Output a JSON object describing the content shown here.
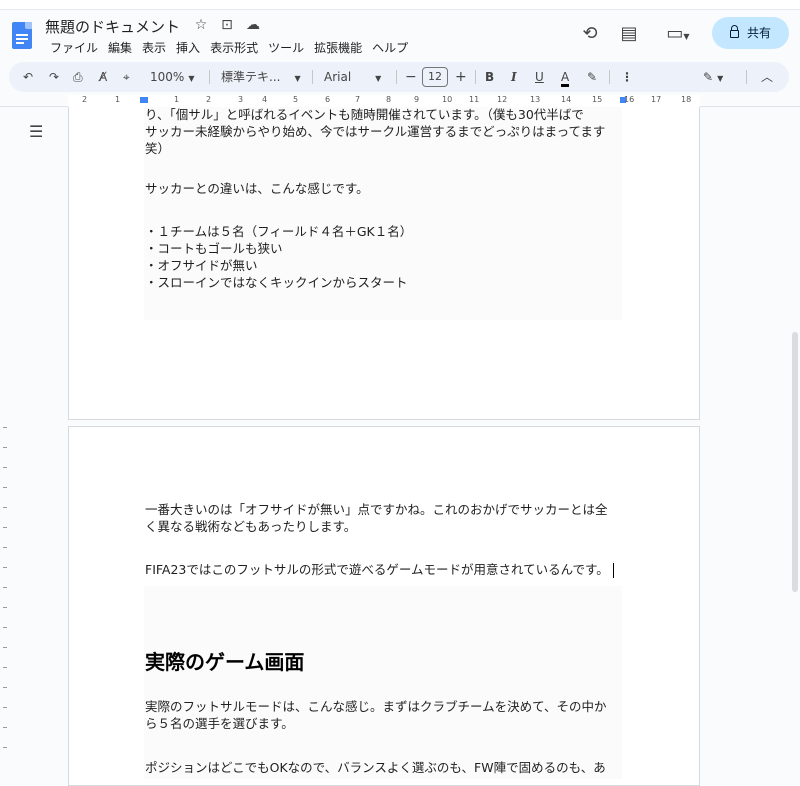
{
  "header": {
    "doc_title": "無題のドキュメント",
    "menus": [
      "ファイル",
      "編集",
      "表示",
      "挿入",
      "表示形式",
      "ツール",
      "拡張機能",
      "ヘルプ"
    ],
    "share_label": "共有"
  },
  "toolbar": {
    "zoom": "100%",
    "style": "標準テキ...",
    "font": "Arial",
    "font_size": "12",
    "bold": "B",
    "italic": "I",
    "underline": "U",
    "text_color": "A"
  },
  "ruler": {
    "numbers": [
      "2",
      "1",
      "1",
      "2",
      "3",
      "4",
      "5",
      "6",
      "7",
      "8",
      "9",
      "10",
      "11",
      "12",
      "13",
      "14",
      "15",
      "16",
      "17",
      "18"
    ]
  },
  "page1": {
    "lines": [
      "り、「個サル」と呼ばれるイベントも随時開催されています。（僕も30代半ばで",
      "サッカー未経験からやり始め、今ではサークル運営するまでどっぷりはまってます",
      "笑）"
    ],
    "diff_intro": "サッカーとの違いは、こんな感じです。",
    "bullets": [
      "・１チームは５名（フィールド４名＋GK１名）",
      "・コートもゴールも狭い",
      "・オフサイドが無い",
      "・スローインではなくキックインからスタート"
    ]
  },
  "page2": {
    "para1": [
      "一番大きいのは「オフサイドが無い」点ですかね。これのおかげでサッカーとは全",
      "く異なる戦術などもあったりします。"
    ],
    "para2": "FIFA23ではこのフットサルの形式で遊べるゲームモードが用意されているんです。",
    "heading": "実際のゲーム画面",
    "para3": [
      "実際のフットサルモードは、こんな感じ。まずはクラブチームを決めて、その中か",
      "ら５名の選手を選びます。"
    ],
    "para4": "ポジションはどこでもOKなので、バランスよく選ぶのも、FW陣で固めるのも、あ"
  }
}
